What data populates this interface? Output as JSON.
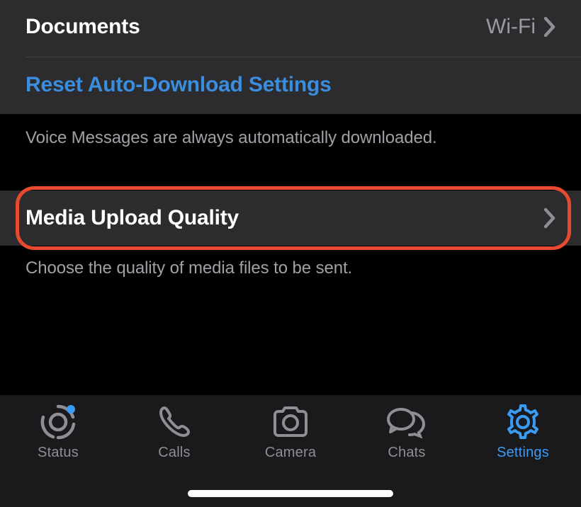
{
  "rows": {
    "documents": {
      "label": "Documents",
      "value": "Wi-Fi"
    },
    "reset": {
      "label": "Reset Auto-Download Settings"
    },
    "media": {
      "label": "Media Upload Quality"
    }
  },
  "notes": {
    "voice": "Voice Messages are always automatically downloaded.",
    "choose": "Choose the quality of media files to be sent."
  },
  "tabs": {
    "status": "Status",
    "calls": "Calls",
    "camera": "Camera",
    "chats": "Chats",
    "settings": "Settings"
  }
}
